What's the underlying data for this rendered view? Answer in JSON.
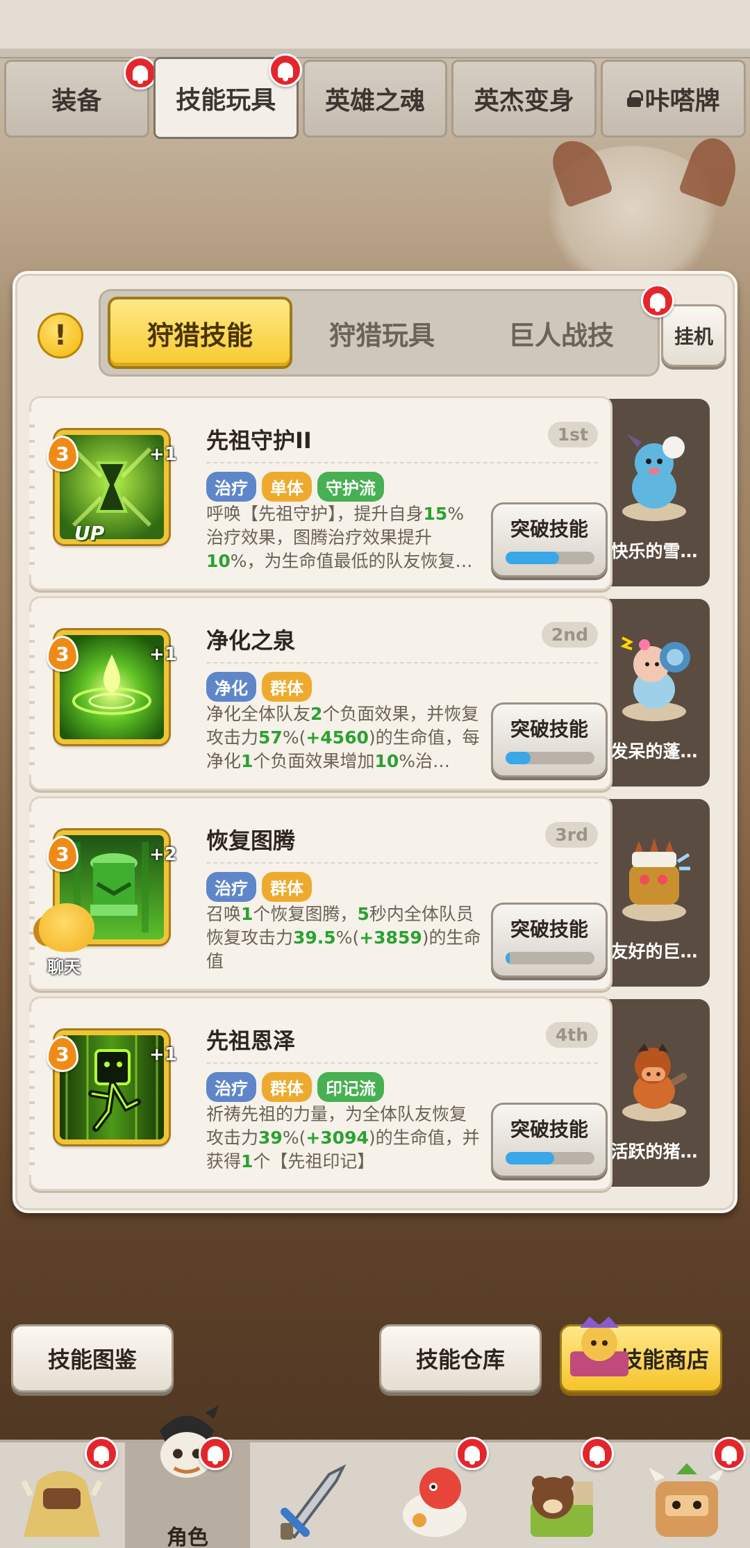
{
  "top_tabs": [
    {
      "label": "装备",
      "active": false,
      "bell": true
    },
    {
      "label": "技能玩具",
      "active": true,
      "bell": true
    },
    {
      "label": "英雄之魂",
      "active": false,
      "bell": false
    },
    {
      "label": "英杰变身",
      "active": false,
      "bell": false
    },
    {
      "label": "咔嗒牌",
      "active": false,
      "bell": false,
      "locked": true
    }
  ],
  "sub_tabs": [
    {
      "label": "狩猎技能",
      "active": true
    },
    {
      "label": "狩猎玩具",
      "active": false
    },
    {
      "label": "巨人战技",
      "active": false
    }
  ],
  "idle_button": "挂机",
  "info_icon": "!",
  "skills": [
    {
      "name": "先祖守护II",
      "rank": "1st",
      "level": "3",
      "plus": "+1",
      "up": "UP",
      "tags": [
        "治疗",
        "单体",
        "守护流"
      ],
      "desc": "呼唤【先祖守护】，提升自身15%治疗效果，图腾治疗效果提升10%，为生命值最低的队友恢复…",
      "button": "突破技能",
      "progress": 0.6,
      "pet": "快乐的雪…",
      "icon": "hourglass-totem-icon"
    },
    {
      "name": "净化之泉",
      "rank": "2nd",
      "level": "3",
      "plus": "+1",
      "tags": [
        "净化",
        "群体"
      ],
      "desc": "净化全体队友2个负面效果，并恢复攻击力57%(+4560)的生命值，每净化1个负面效果增加10%治…",
      "button": "突破技能",
      "progress": 0.28,
      "pet": "发呆的蓬…",
      "icon": "spring-drop-icon"
    },
    {
      "name": "恢复图腾",
      "rank": "3rd",
      "level": "3",
      "plus": "+2",
      "tags": [
        "治疗",
        "群体"
      ],
      "desc": "召唤1个恢复图腾，5秒内全体队员恢复攻击力39.5%(+3859)的生命值",
      "button": "突破技能",
      "progress": 0.05,
      "pet": "友好的巨…",
      "icon": "totem-icon"
    },
    {
      "name": "先祖恩泽",
      "rank": "4th",
      "level": "3",
      "plus": "+1",
      "tags": [
        "治疗",
        "群体",
        "印记流"
      ],
      "desc": "祈祷先祖的力量，为全体队友恢复攻击力39%(+3094)的生命值，并获得1个【先祖印记】",
      "button": "突破技能",
      "progress": 0.55,
      "pet": "活跃的猪…",
      "icon": "ancestor-spirit-icon"
    }
  ],
  "chat_label": "聊天",
  "bottom_buttons": {
    "codex": "技能图鉴",
    "warehouse": "技能仓库",
    "shop": "技能商店"
  },
  "bottom_nav": [
    {
      "label": "",
      "bell": true
    },
    {
      "label": "角色",
      "bell": true,
      "active": true
    },
    {
      "label": "",
      "bell": false
    },
    {
      "label": "",
      "bell": true
    },
    {
      "label": "",
      "bell": true
    },
    {
      "label": "",
      "bell": true
    }
  ],
  "colors": {
    "accent_gold": "#f6cb2e",
    "tag_blue": "#5e86c9",
    "tag_orange": "#eeaa2e",
    "tag_green": "#47b052",
    "progress_blue": "#39a7e8",
    "bell_red": "#e4262c"
  }
}
